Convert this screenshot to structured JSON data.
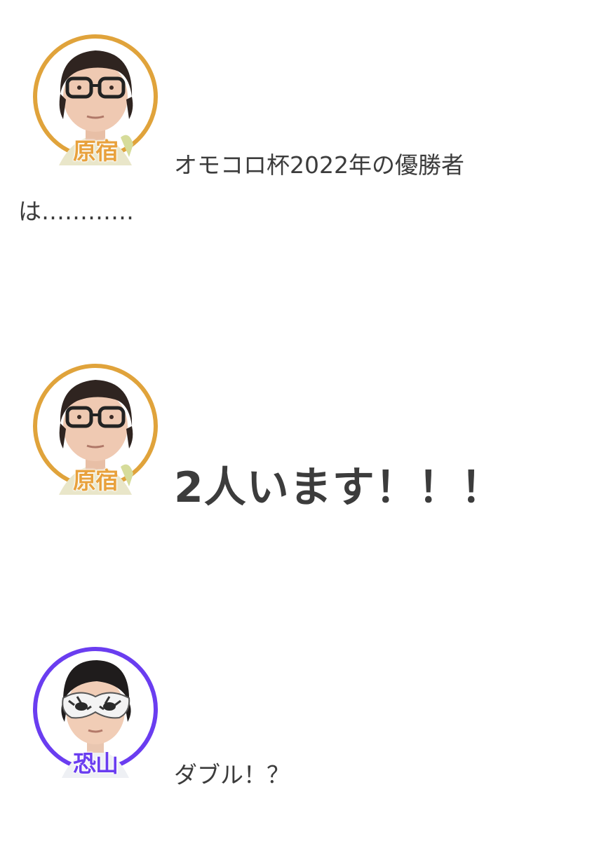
{
  "messages": [
    {
      "speaker": "原宿",
      "avatar_icon": "man-with-glasses-avatar-icon",
      "ring_color": "#e0a33b",
      "label_color": "#e8a13c",
      "text_line1": "オモコロ杯2022年の優勝者",
      "text_line2": "は…………"
    },
    {
      "speaker": "原宿",
      "avatar_icon": "man-with-glasses-avatar-icon",
      "ring_color": "#e0a33b",
      "label_color": "#e8a13c",
      "text": "2人います！！！"
    },
    {
      "speaker": "恐山",
      "avatar_icon": "masked-man-avatar-icon",
      "ring_color": "#6a3df0",
      "label_color": "#6a3df0",
      "text": "ダブル！？"
    }
  ]
}
